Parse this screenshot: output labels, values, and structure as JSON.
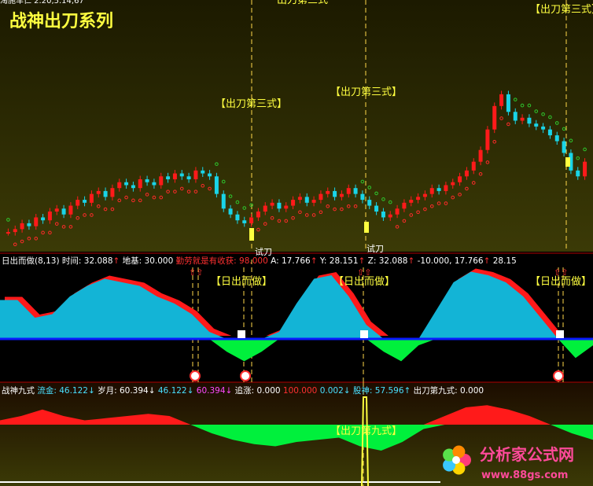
{
  "title": "战神出刀系列",
  "colors": {
    "bg_top": "#1e1e00",
    "bg_mid": "#3a3a05",
    "up": "#ff1a1a",
    "down": "#19d4e8",
    "sar": "#ff2a2a",
    "sar_green": "#2ec82e",
    "cloud": "#13b4d6",
    "cloud_red": "#ff1a1a",
    "green": "#00f03c",
    "baseline": "#0a1aff",
    "yellow": "#ffff40",
    "white": "#ffffff"
  },
  "top_panel": {
    "header_fragment": "淘施车仁 2.20,5.14,67",
    "annotations": [
      {
        "label": "【出刀第三式】"
      },
      {
        "label": "【出刀第三式】"
      },
      {
        "label": "【出刀第三式】"
      },
      {
        "label": "出刀第三式"
      }
    ],
    "small_labels": [
      "试刀",
      "试刀"
    ]
  },
  "mid_panel": {
    "header_segments": [
      {
        "text": "日出而做(8,13) 时间: 32.088",
        "color": "#ffffff"
      },
      {
        "text": "↑",
        "color": "#ff3030"
      },
      {
        "text": " 地基: 30.000 ",
        "color": "#ffffff"
      },
      {
        "text": "勤劳就是有收获: 98.000",
        "color": "#ff3030"
      },
      {
        "text": " A: 17.766",
        "color": "#ffffff"
      },
      {
        "text": "↑",
        "color": "#ff3030"
      },
      {
        "text": " Y: 28.151",
        "color": "#ffffff"
      },
      {
        "text": "↑",
        "color": "#ff3030"
      },
      {
        "text": " Z: 32.088",
        "color": "#ffffff"
      },
      {
        "text": "↑",
        "color": "#ff3030"
      },
      {
        "text": " -10.000, 17.766",
        "color": "#ffffff"
      },
      {
        "text": "↑",
        "color": "#ff3030"
      },
      {
        "text": " 28.15",
        "color": "#ffffff"
      }
    ],
    "labels": [
      "【日出而做】",
      "【日出而做】",
      "【日出而做】"
    ]
  },
  "bottom_panel": {
    "header_segments": [
      {
        "text": "战神九式",
        "color": "#ffffff"
      },
      {
        "text": " 流金: 46.122↓",
        "color": "#4ae0ff"
      },
      {
        "text": " 岁月: 60.394↓",
        "color": "#ffffff"
      },
      {
        "text": " 46.122↓",
        "color": "#4ae0ff"
      },
      {
        "text": " 60.394↓",
        "color": "#ff4aff"
      },
      {
        "text": " 追涨: 0.000",
        "color": "#ffffff"
      },
      {
        "text": " 100.000",
        "color": "#ff3030"
      },
      {
        "text": " 0.002↓",
        "color": "#4ae0ff"
      },
      {
        "text": " 股神: 57.596↑",
        "color": "#4ae0ff"
      },
      {
        "text": " 出刀第九式: 0.000",
        "color": "#ffffff"
      }
    ],
    "label": "【出刀第九式】"
  },
  "watermark": {
    "name": "分析家公式网",
    "url": "www.88gs.com"
  },
  "chart_data": [
    {
      "type": "candlestick",
      "panel": "price",
      "title": "战神出刀系列",
      "series": [
        {
          "name": "close",
          "values": [
            9,
            10,
            12,
            11,
            14,
            13,
            16,
            17,
            15,
            18,
            20,
            19,
            22,
            23,
            21,
            24,
            26,
            25,
            24,
            27,
            26,
            25,
            28,
            27,
            29,
            28,
            27,
            30,
            29,
            28,
            22,
            17,
            15,
            13,
            12,
            14,
            16,
            18,
            19,
            17,
            18,
            20,
            21,
            19,
            20,
            22,
            23,
            21,
            22,
            24,
            22,
            20,
            18,
            16,
            14,
            15,
            17,
            19,
            20,
            21,
            22,
            24,
            23,
            25,
            26,
            28,
            30,
            33,
            37,
            44,
            52,
            56,
            50,
            47,
            48,
            46,
            45,
            44,
            42,
            40,
            36,
            30,
            28,
            33
          ]
        }
      ]
    },
    {
      "type": "area",
      "panel": "日出而做",
      "series": [
        {
          "name": "日出而做",
          "values": [
            0.55,
            0.55,
            0.3,
            0.35,
            0.6,
            0.75,
            0.85,
            0.8,
            0.75,
            0.6,
            0.5,
            0.35,
            0.1,
            -0.2,
            -0.35,
            -0.2,
            0.1,
            0.5,
            0.85,
            0.9,
            0.6,
            0.2,
            -0.2,
            -0.35,
            -0.1,
            0.4,
            0.8,
            0.95,
            0.9,
            0.8,
            0.6,
            0.3,
            0.0,
            -0.3,
            -0.1
          ]
        }
      ]
    },
    {
      "type": "area",
      "panel": "战神九式",
      "series": [
        {
          "name": "战神九式",
          "values": [
            0.1,
            0.2,
            0.35,
            0.2,
            0.1,
            0.15,
            0.2,
            0.25,
            0.2,
            0.0,
            -0.2,
            -0.35,
            -0.45,
            -0.5,
            -0.4,
            -0.35,
            -0.3,
            -0.5,
            -0.6,
            -0.4,
            -0.1,
            0.2,
            0.4,
            0.45,
            0.35,
            0.2,
            0.0,
            -0.2,
            -0.35
          ]
        }
      ]
    }
  ]
}
